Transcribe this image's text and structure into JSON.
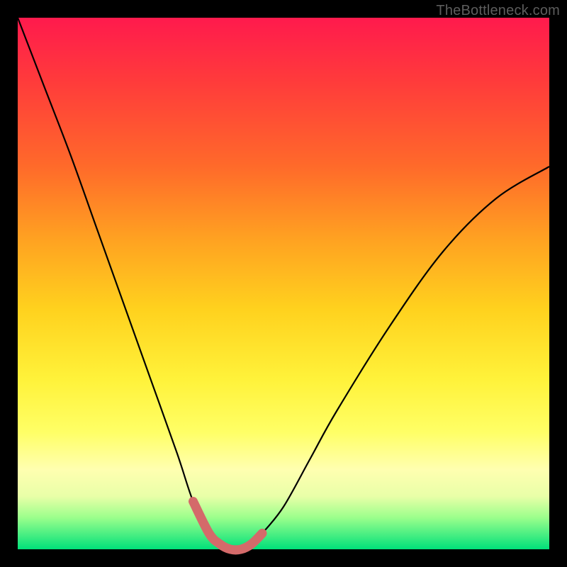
{
  "watermark": "TheBottleneck.com",
  "chart_data": {
    "type": "line",
    "title": "",
    "xlabel": "",
    "ylabel": "",
    "xlim": [
      0,
      1
    ],
    "ylim": [
      0,
      1
    ],
    "series": [
      {
        "name": "bottleneck-curve",
        "x": [
          0.0,
          0.05,
          0.1,
          0.15,
          0.2,
          0.25,
          0.3,
          0.33,
          0.36,
          0.38,
          0.4,
          0.42,
          0.44,
          0.46,
          0.5,
          0.55,
          0.6,
          0.7,
          0.8,
          0.9,
          1.0
        ],
        "y": [
          1.0,
          0.87,
          0.74,
          0.6,
          0.46,
          0.32,
          0.18,
          0.09,
          0.03,
          0.01,
          0.0,
          0.0,
          0.01,
          0.03,
          0.08,
          0.17,
          0.26,
          0.42,
          0.56,
          0.66,
          0.72
        ]
      }
    ],
    "highlight": {
      "name": "trough-region",
      "xrange": [
        0.33,
        0.46
      ],
      "color": "#d46a6a"
    }
  },
  "colors": {
    "curve": "#000000",
    "highlight": "#d46a6a",
    "frame": "#000000"
  }
}
